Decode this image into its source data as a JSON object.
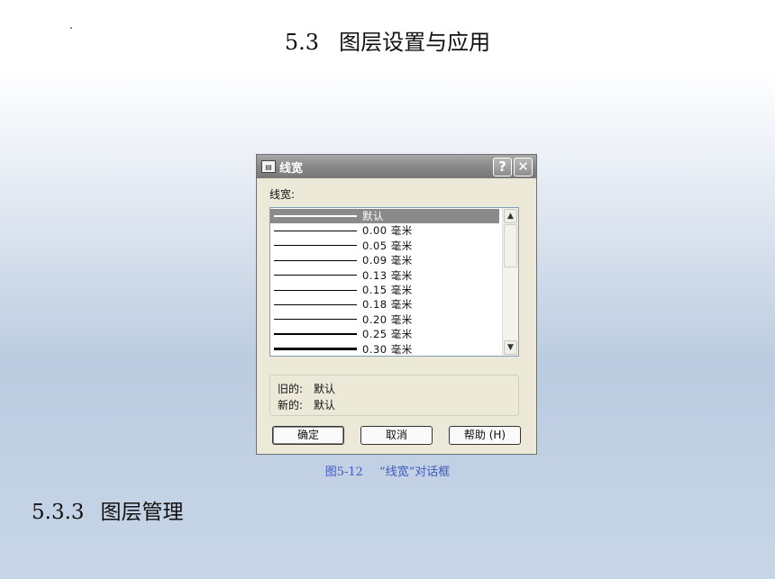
{
  "slide": {
    "title_number": "5.3",
    "title_text": "图层设置与应用",
    "section_number": "5.3.3",
    "section_text": "图层管理",
    "caption_figure": "图5-12",
    "caption_text": "“线宽”对话框"
  },
  "dialog": {
    "title": "线宽",
    "help_glyph": "?",
    "close_glyph": "✕",
    "lineweight_label": "线宽:",
    "items": [
      {
        "label": "默认",
        "weight": 1.5,
        "selected": true
      },
      {
        "label": "0.00 毫米",
        "weight": 1,
        "selected": false
      },
      {
        "label": "0.05 毫米",
        "weight": 1,
        "selected": false
      },
      {
        "label": "0.09 毫米",
        "weight": 1,
        "selected": false
      },
      {
        "label": "0.13 毫米",
        "weight": 1,
        "selected": false
      },
      {
        "label": "0.15 毫米",
        "weight": 1,
        "selected": false
      },
      {
        "label": "0.18 毫米",
        "weight": 1,
        "selected": false
      },
      {
        "label": "0.20 毫米",
        "weight": 1,
        "selected": false
      },
      {
        "label": "0.25 毫米",
        "weight": 1.5,
        "selected": false
      },
      {
        "label": "0.30 毫米",
        "weight": 3,
        "selected": false
      }
    ],
    "old_label": "旧的:",
    "old_value": "默认",
    "new_label": "新的:",
    "new_value": "默认",
    "ok_label": "确定",
    "cancel_label": "取消",
    "help_label": "帮助 (H)"
  },
  "colors": {
    "caption": "#3f59c2",
    "titlebar": "#8a8a8a",
    "dialog_bg": "#ece9d8"
  }
}
